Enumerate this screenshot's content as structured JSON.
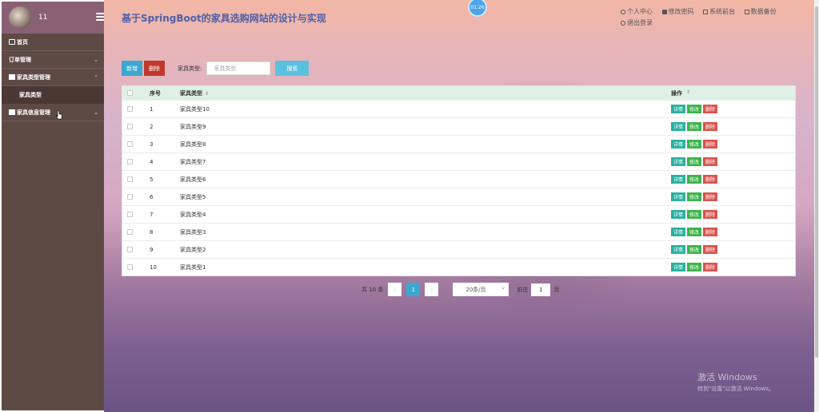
{
  "user": {
    "name": "11"
  },
  "app": {
    "title": "基于SpringBoot的家具选购网站的设计与实现",
    "clock": "01:26"
  },
  "sidebar": {
    "items": [
      {
        "label": "首页",
        "icon": "home-icon"
      },
      {
        "label": "订单管理",
        "icon": "list-icon",
        "chevron": "⌄"
      },
      {
        "label": "家具类型管理",
        "icon": "folder-icon",
        "chevron": "⌃"
      },
      {
        "label": "家具类型",
        "sub": true
      },
      {
        "label": "家具信息管理",
        "icon": "grid-icon",
        "chevron": "⌄"
      }
    ]
  },
  "header": {
    "links": [
      {
        "label": "个人中心",
        "icon": "user-icon"
      },
      {
        "label": "修改密码",
        "icon": "lock-icon"
      },
      {
        "label": "系统前台",
        "icon": "home-icon"
      },
      {
        "label": "数据备份",
        "icon": "folder-icon"
      },
      {
        "label": "退出登录",
        "icon": "logout-icon"
      }
    ]
  },
  "toolbar": {
    "add_label": "新增",
    "delete_label": "删除",
    "type_label": "家具类型:",
    "type_placeholder": "家具类型",
    "search_label": "搜索"
  },
  "table": {
    "headers": {
      "no": "序号",
      "type": "家具类型",
      "ops": "操作"
    },
    "rows": [
      {
        "no": "1",
        "type": "家具类型10"
      },
      {
        "no": "2",
        "type": "家具类型9"
      },
      {
        "no": "3",
        "type": "家具类型8"
      },
      {
        "no": "4",
        "type": "家具类型7"
      },
      {
        "no": "5",
        "type": "家具类型6"
      },
      {
        "no": "6",
        "type": "家具类型5"
      },
      {
        "no": "7",
        "type": "家具类型4"
      },
      {
        "no": "8",
        "type": "家具类型3"
      },
      {
        "no": "9",
        "type": "家具类型2"
      },
      {
        "no": "10",
        "type": "家具类型1"
      }
    ],
    "row_actions": {
      "detail": "详情",
      "edit": "修改",
      "delete": "删除"
    }
  },
  "pager": {
    "total": "共 10 条",
    "prev": "‹",
    "current": "1",
    "next": "›",
    "page_size": "20条/页",
    "goto_label": "前往",
    "goto_value": "1",
    "page_suffix": "页"
  },
  "watermark": {
    "line1": "激活 Windows",
    "line2": "转到\"设置\"以激活 Windows。"
  },
  "colors": {
    "primary": "#3aa8d0",
    "danger": "#c0392b",
    "success": "#3cb44b",
    "teal": "#2ab0a0",
    "sidebar": "#5e4a45"
  }
}
